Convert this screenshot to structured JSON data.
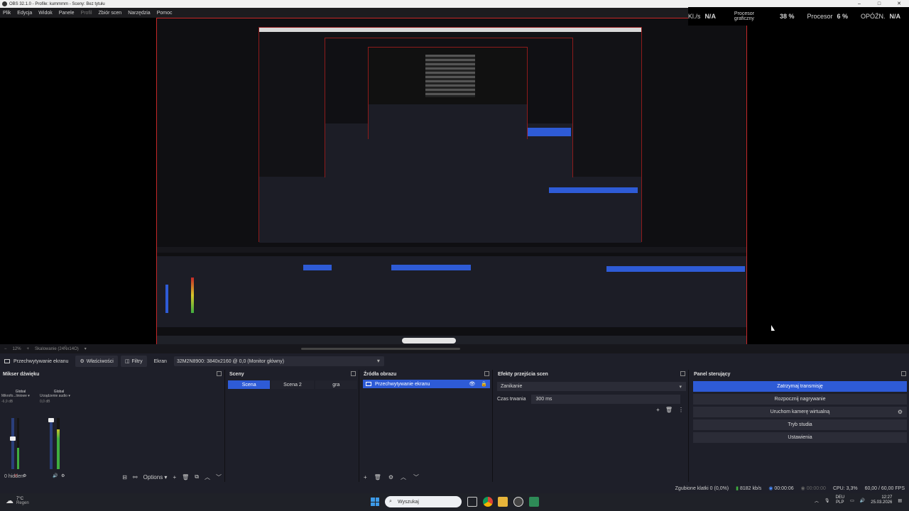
{
  "window": {
    "title": "OBS 32.1.0 - Profile: kummmm - Sceny: Bez tytułu"
  },
  "menu": {
    "items": [
      "Plik",
      "Edycja",
      "Widok",
      "Panele",
      "Profil",
      "Zbiór scen",
      "Narzędzia",
      "Pomoc"
    ]
  },
  "stats": {
    "kl_label": "Kl./s",
    "kl_value": "N/A",
    "gpu_label": "Procesor graficzny",
    "gpu_value": "38 %",
    "cpu_label": "Procesor",
    "cpu_value": "6 %",
    "delay_label": "OPÓŹN.",
    "delay_value": "N/A"
  },
  "preview_bar": {
    "zoom": "12%",
    "scaling": "Skalowanie (24Ñx14O)"
  },
  "source_toolbar": {
    "source_name": "Przechwytywanie ekranu",
    "properties_label": "Właściwości",
    "filters_label": "Filtry",
    "screen_label": "Ekran",
    "monitor_value": "32M2N8900: 3840x2160 @ 0,0 (Monitor główny)"
  },
  "mixer": {
    "title": "Mikser dźwięku",
    "channels": [
      {
        "global": "Global",
        "name": "Mikrofo...liniowe",
        "db": "-6,9 dB",
        "level": 0.42
      },
      {
        "global": "Global",
        "name": "Urządzenie audio",
        "db": "0,0 dB",
        "level": 0.78
      }
    ],
    "hidden_label": "0 hidden",
    "options_label": "Options"
  },
  "scenes": {
    "title": "Sceny",
    "items": [
      {
        "label": "Scena",
        "selected": true
      },
      {
        "label": "Scena 2",
        "selected": false
      },
      {
        "label": "gra",
        "selected": false
      }
    ]
  },
  "sources": {
    "title": "Źródła obrazu",
    "items": [
      {
        "label": "Przechwytywanie ekranu",
        "selected": true
      }
    ]
  },
  "transitions": {
    "title": "Efekty przejścia scen",
    "effect": "Zanikanie",
    "duration_label": "Czas trwania",
    "duration_value": "300 ms"
  },
  "controls": {
    "title": "Panel sterujący",
    "stop_stream": "Zatrzymaj transmisję",
    "start_recording": "Rozpocznij nagrywanie",
    "virtual_cam": "Uruchom kamerę wirtualną",
    "studio_mode": "Tryb studia",
    "settings": "Ustawienia"
  },
  "statusbar": {
    "dropped": "Zgubione klatki 0 (0,0%)",
    "bitrate": "8182 kb/s",
    "stream_time": "00:00:06",
    "rec_time": "00:00:00",
    "cpu": "CPU: 3,3%",
    "fps": "60,00 / 60,00 FPS"
  },
  "taskbar": {
    "weather_temp": "7°C",
    "weather_desc": "Regen",
    "search_placeholder": "Wyszukaj",
    "lang": "DEU",
    "kbd": "PLP",
    "time": "12:27",
    "date": "25.03.2026"
  },
  "colors": {
    "accent": "#2e5bd6",
    "border_red": "#c62828",
    "bg": "#1e1f29"
  }
}
